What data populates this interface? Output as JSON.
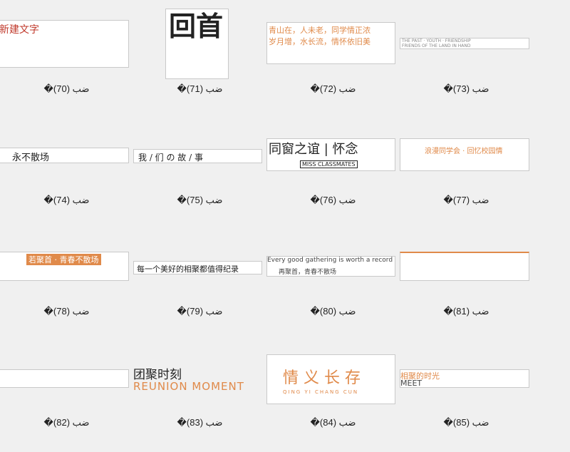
{
  "colors": {
    "orange": "#e08a4a",
    "red": "#c0392b",
    "dark": "#222222"
  },
  "items": [
    {
      "label": "�ضب (70)",
      "text": "新建文字"
    },
    {
      "label": "�ضب (71)",
      "text": "回首"
    },
    {
      "label": "�ضب (72)",
      "text1": "青山在，人未老，同学情正浓",
      "text2": "岁月增，水长流，情怀依旧美"
    },
    {
      "label": "�ضب (73)",
      "text1": "THE PAST · YOUTH · FRIENDSHIP",
      "text2": "FRIENDS OF THE LAND IN HAND"
    },
    {
      "label": "�ضب (74)",
      "text": "永不散场"
    },
    {
      "label": "�ضب (75)",
      "text": "我 / 们 の 故 / 事"
    },
    {
      "label": "�ضب (76)",
      "text1": "同窗之谊 | 怀念",
      "text2": "MISS CLASSMATES"
    },
    {
      "label": "�ضب (77)",
      "text": "浪漫同学会 · 回忆校园情"
    },
    {
      "label": "�ضب (78)",
      "text": "若聚首 · 青春不散场"
    },
    {
      "label": "�ضب (79)",
      "text": "每一个美好的相聚都值得纪录"
    },
    {
      "label": "�ضب (80)",
      "text1": "Every good gathering is worth a record",
      "text2": "再聚首，青春不散场"
    },
    {
      "label": "�ضب (81)",
      "text": ""
    },
    {
      "label": "�ضب (82)",
      "text": ""
    },
    {
      "label": "�ضب (83)",
      "text1": "团聚时刻",
      "text2": "REUNION MOMENT"
    },
    {
      "label": "�ضب (84)",
      "text1": "情 义 长 存",
      "text2": "QING  YI  CHANG  CUN"
    },
    {
      "label": "�ضب (85)",
      "text1": "相聚的时光",
      "text2": "MEET"
    }
  ]
}
